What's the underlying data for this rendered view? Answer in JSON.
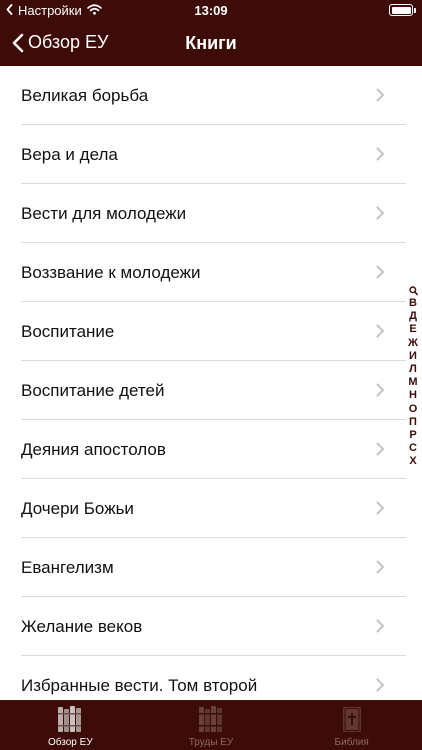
{
  "status_bar": {
    "carrier": "Настройки",
    "time": "13:09"
  },
  "nav": {
    "back_label": "Обзор ЕУ",
    "title": "Книги"
  },
  "books": [
    "Великая борьба",
    "Вера и дела",
    "Вести для молодежи",
    "Воззвание к молодежи",
    "Воспитание",
    "Воспитание детей",
    "Деяния апостолов",
    "Дочери Божьи",
    "Евангелизм",
    "Желание веков",
    "Избранные вести. Том второй"
  ],
  "index_letters": [
    "В",
    "Д",
    "Е",
    "Ж",
    "И",
    "Л",
    "М",
    "Н",
    "О",
    "П",
    "Р",
    "С",
    "Х"
  ],
  "tabs": [
    {
      "label": "Обзор ЕУ",
      "icon": "books-icon",
      "active": true
    },
    {
      "label": "Труды ЕУ",
      "icon": "books-icon",
      "active": false
    },
    {
      "label": "Библия",
      "icon": "bible-icon",
      "active": false
    }
  ],
  "colors": {
    "brand": "#3e0c08",
    "index_text": "#3e0c08",
    "tab_inactive": "#8a6a66"
  }
}
